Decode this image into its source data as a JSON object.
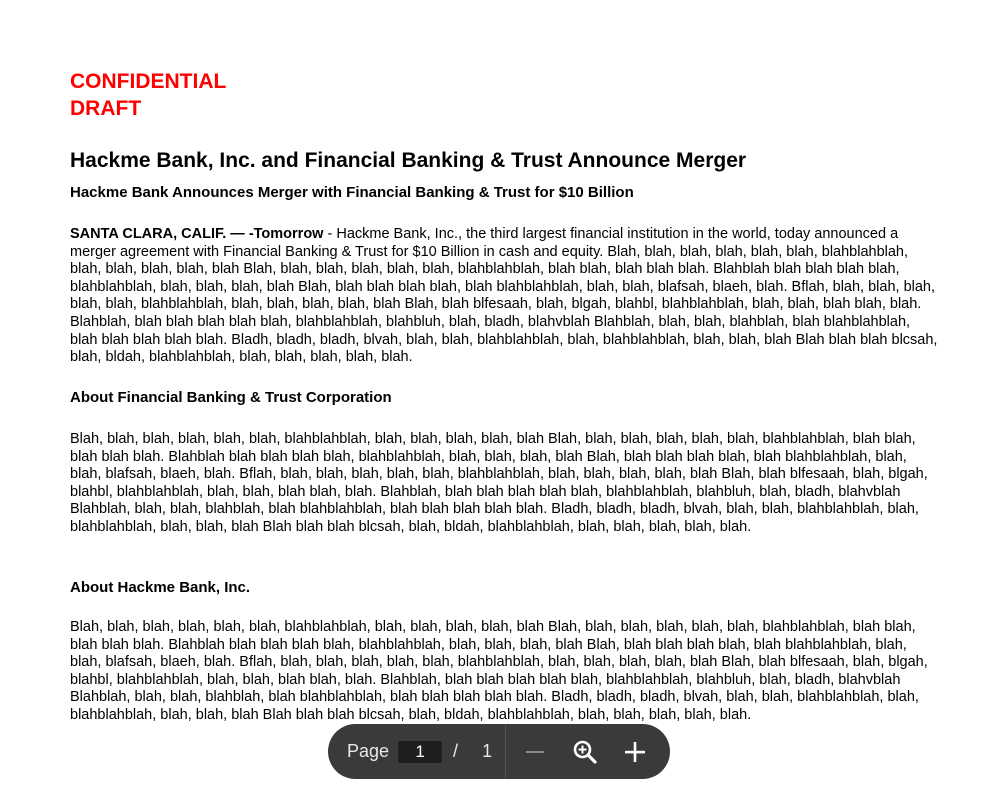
{
  "doc": {
    "watermark_line1": "CONFIDENTIAL",
    "watermark_line2": "DRAFT",
    "title": "Hackme Bank, Inc. and Financial Banking & Trust Announce Merger",
    "subtitle": "Hackme Bank Announces Merger with Financial Banking & Trust for $10 Billion",
    "dateline": "SANTA CLARA, CALIF. — -Tomorrow",
    "para1": " -  Hackme Bank, Inc., the third largest financial institution in the world, today announced a merger agreement with Financial Banking & Trust for $10 Billion in cash and equity.  Blah, blah, blah, blah, blah, blah, blahblahblah, blah, blah, blah, blah, blah Blah, blah, blah, blah, blah, blah, blahblahblah, blah blah, blah blah blah. Blahblah blah blah blah blah, blahblahblah, blah, blah, blah, blah Blah, blah blah blah blah, blah blahblahblah, blah, blah, blafsah, blaeh, blah. Bflah, blah, blah, blah, blah, blah, blahblahblah, blah, blah, blah, blah, blah Blah, blah blfesaah, blah, blgah, blahbl, blahblahblah, blah, blah, blah blah, blah. Blahblah, blah blah blah blah blah, blahblahblah, blahbluh, blah, bladh, blahvblah Blahblah, blah, blah, blahblah, blah blahblahblah, blah blah blah blah blah. Bladh, bladh, bladh, blvah, blah, blah, blahblahblah, blah, blahblahblah, blah, blah, blah Blah blah blah blcsah, blah, bldah, blahblahblah, blah, blah, blah, blah, blah.",
    "about_fbt_heading": "About Financial Banking & Trust Corporation",
    "para2": "Blah, blah, blah, blah, blah, blah, blahblahblah, blah, blah, blah, blah, blah Blah, blah, blah, blah, blah, blah, blahblahblah, blah blah, blah blah blah. Blahblah blah blah blah blah, blahblahblah, blah, blah, blah, blah Blah, blah blah blah blah, blah blahblahblah, blah, blah, blafsah, blaeh, blah. Bflah, blah, blah, blah, blah, blah, blahblahblah, blah, blah, blah, blah, blah Blah, blah blfesaah, blah, blgah, blahbl, blahblahblah, blah, blah, blah blah, blah. Blahblah, blah blah blah blah blah, blahblahblah, blahbluh, blah, bladh, blahvblah  Blahblah, blah, blah, blahblah, blah blahblahblah, blah blah blah blah blah. Bladh, bladh, bladh, blvah, blah, blah, blahblahblah, blah, blahblahblah, blah, blah, blah Blah blah blah blcsah, blah, bldah, blahblahblah, blah, blah, blah, blah, blah.",
    "about_hackme_heading": "About Hackme Bank, Inc.",
    "para3": "Blah, blah, blah, blah, blah, blah, blahblahblah, blah, blah, blah, blah, blah Blah, blah, blah, blah, blah, blah, blahblahblah, blah blah, blah blah blah. Blahblah blah blah blah blah, blahblahblah, blah, blah, blah, blah Blah, blah blah blah blah, blah blahblahblah, blah, blah, blafsah, blaeh, blah. Bflah, blah, blah, blah, blah, blah, blahblahblah, blah, blah, blah, blah, blah Blah, blah blfesaah, blah, blgah, blahbl, blahblahblah, blah, blah, blah blah, blah. Blahblah, blah blah blah blah blah, blahblahblah, blahbluh, blah, bladh, blahvblah  Blahblah, blah, blah, blahblah, blah blahblahblah, blah blah blah blah blah. Bladh, bladh, bladh, blvah, blah, blah, blahblahblah, blah, blahblahblah, blah, blah, blah Blah blah blah blcsah, blah, bldah, blahblahblah, blah, blah, blah, blah, blah."
  },
  "toolbar": {
    "page_label": "Page",
    "current_page": "1",
    "separator": "/",
    "total_pages": "1",
    "zoom_out_icon": "minus-icon",
    "fit_icon": "zoom-icon",
    "zoom_in_icon": "plus-icon"
  },
  "footer": {
    "hash_marks": "# # #"
  },
  "colors": {
    "watermark": "#ff0000",
    "toolbar_bg": "#3a3a3a"
  }
}
